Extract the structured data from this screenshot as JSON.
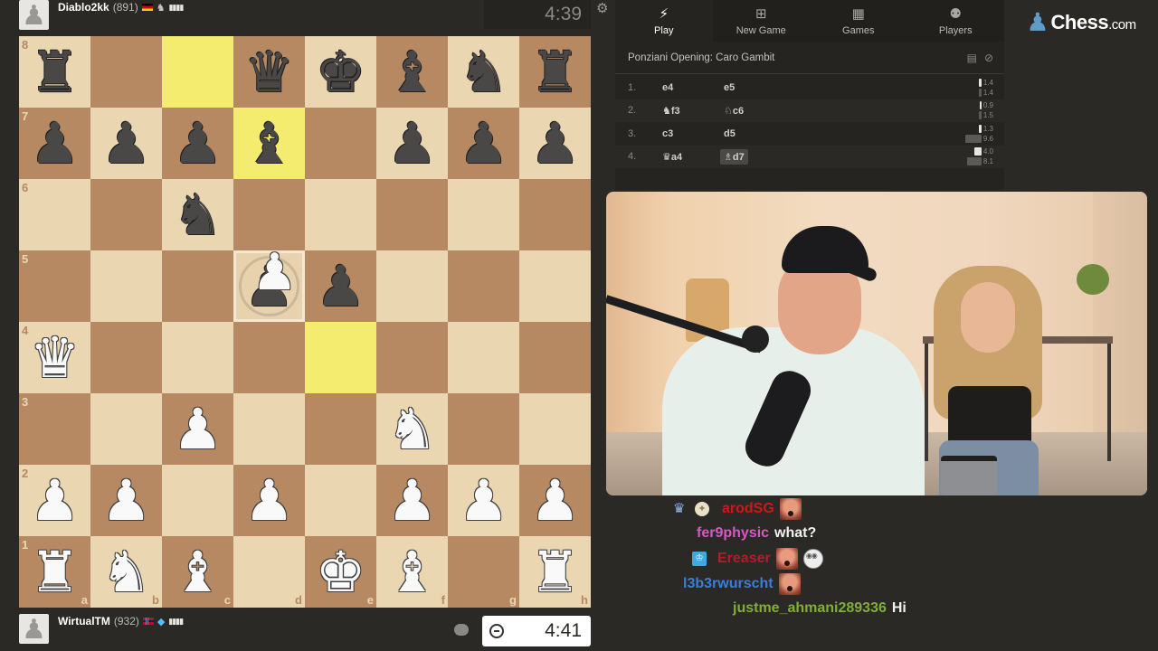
{
  "top_player": {
    "name": "Diablo2kk",
    "rating": "(891)",
    "flag": "Germany",
    "clock": "4:39",
    "avatar_icon": "pawn-icon",
    "badge_icon": "knight-badge-icon",
    "connection_icon": "signal-bars-icon"
  },
  "bottom_player": {
    "name": "WirtualTM",
    "rating": "(932)",
    "flag": "Norway",
    "clock": "4:41",
    "avatar_icon": "pawn-icon",
    "badge_icon": "diamond-icon",
    "connection_icon": "signal-bars-icon"
  },
  "board": {
    "orientation": "white",
    "ranks": [
      "8",
      "7",
      "6",
      "5",
      "4",
      "3",
      "2",
      "1"
    ],
    "files": [
      "a",
      "b",
      "c",
      "d",
      "e",
      "f",
      "g",
      "h"
    ],
    "position": [
      [
        "bR",
        "",
        "",
        "bQ",
        "bK",
        "bB",
        "bN",
        "bR"
      ],
      [
        "bP",
        "bP",
        "bP",
        "bB",
        "",
        "bP",
        "bP",
        "bP"
      ],
      [
        "",
        "",
        "bN",
        "",
        "",
        "",
        "",
        ""
      ],
      [
        "",
        "",
        "",
        "bP",
        "bP",
        "",
        "",
        ""
      ],
      [
        "wQ",
        "",
        "",
        "",
        "",
        "",
        "",
        ""
      ],
      [
        "",
        "",
        "wP",
        "",
        "",
        "wN",
        "",
        ""
      ],
      [
        "wP",
        "wP",
        "",
        "wP",
        "",
        "wP",
        "wP",
        "wP"
      ],
      [
        "wR",
        "wN",
        "wB",
        "",
        "wK",
        "wB",
        "",
        "wR"
      ]
    ],
    "highlighted_squares": [
      "c8",
      "d7",
      "e4"
    ],
    "dragging": {
      "piece": "wP",
      "from": "e4",
      "over": "d5"
    },
    "colors": {
      "light": "#ebd6b2",
      "dark": "#b68962",
      "highlight": "#f3ec6e"
    }
  },
  "nav": {
    "tabs": [
      {
        "label": "Play",
        "icon": "lightning-icon",
        "glyph": "⚡",
        "active": true
      },
      {
        "label": "New Game",
        "icon": "plus-square-icon",
        "glyph": "⊞",
        "active": false
      },
      {
        "label": "Games",
        "icon": "checkerboard-icon",
        "glyph": "▦",
        "active": false
      },
      {
        "label": "Players",
        "icon": "players-icon",
        "glyph": "👥",
        "active": false
      }
    ]
  },
  "logo": {
    "text": "Chess",
    "suffix": ".com"
  },
  "opening": {
    "name": "Ponziani Opening: Caro Gambit",
    "icons": [
      "book-icon",
      "compass-icon"
    ]
  },
  "moves": [
    {
      "no": "1.",
      "white": "e4",
      "white_piece": "",
      "black": "e5",
      "black_piece": "",
      "white_time": "1.4",
      "black_time": "1.4",
      "current": false
    },
    {
      "no": "2.",
      "white": "f3",
      "white_piece": "♞",
      "black": "c6",
      "black_piece": "♘",
      "white_time": "0.9",
      "black_time": "1.5",
      "current": false
    },
    {
      "no": "3.",
      "white": "c3",
      "white_piece": "",
      "black": "d5",
      "black_piece": "",
      "white_time": "1.3",
      "black_time": "9.6",
      "current": false
    },
    {
      "no": "4.",
      "white": "a4",
      "white_piece": "♛",
      "black": "d7",
      "black_piece": "♗",
      "white_time": "4.0",
      "black_time": "8.1",
      "current": true
    }
  ],
  "chat": {
    "messages": [
      {
        "user": "arodSG",
        "color": "#d4141a",
        "badges": [
          "crystal-badge",
          "coin-badge"
        ],
        "text": "",
        "emotes": [
          "face-emote"
        ]
      },
      {
        "user": "fer9physic",
        "color": "#d25ac2",
        "badges": [],
        "text": "what?",
        "emotes": []
      },
      {
        "user": "Ereaser",
        "color": "#b21c2a",
        "badges": [
          "crown-badge"
        ],
        "text": "",
        "emotes": [
          "face-emote",
          "troll-emote"
        ]
      },
      {
        "user": "l3b3rwurscht",
        "color": "#3a7fd5",
        "badges": [],
        "text": "",
        "emotes": [
          "face-emote"
        ]
      },
      {
        "user": "justme_ahmani289336",
        "color": "#7fae3a",
        "badges": [],
        "text": "Hi",
        "emotes": []
      }
    ]
  },
  "webcam": {
    "description": "streamer webcam feed"
  }
}
